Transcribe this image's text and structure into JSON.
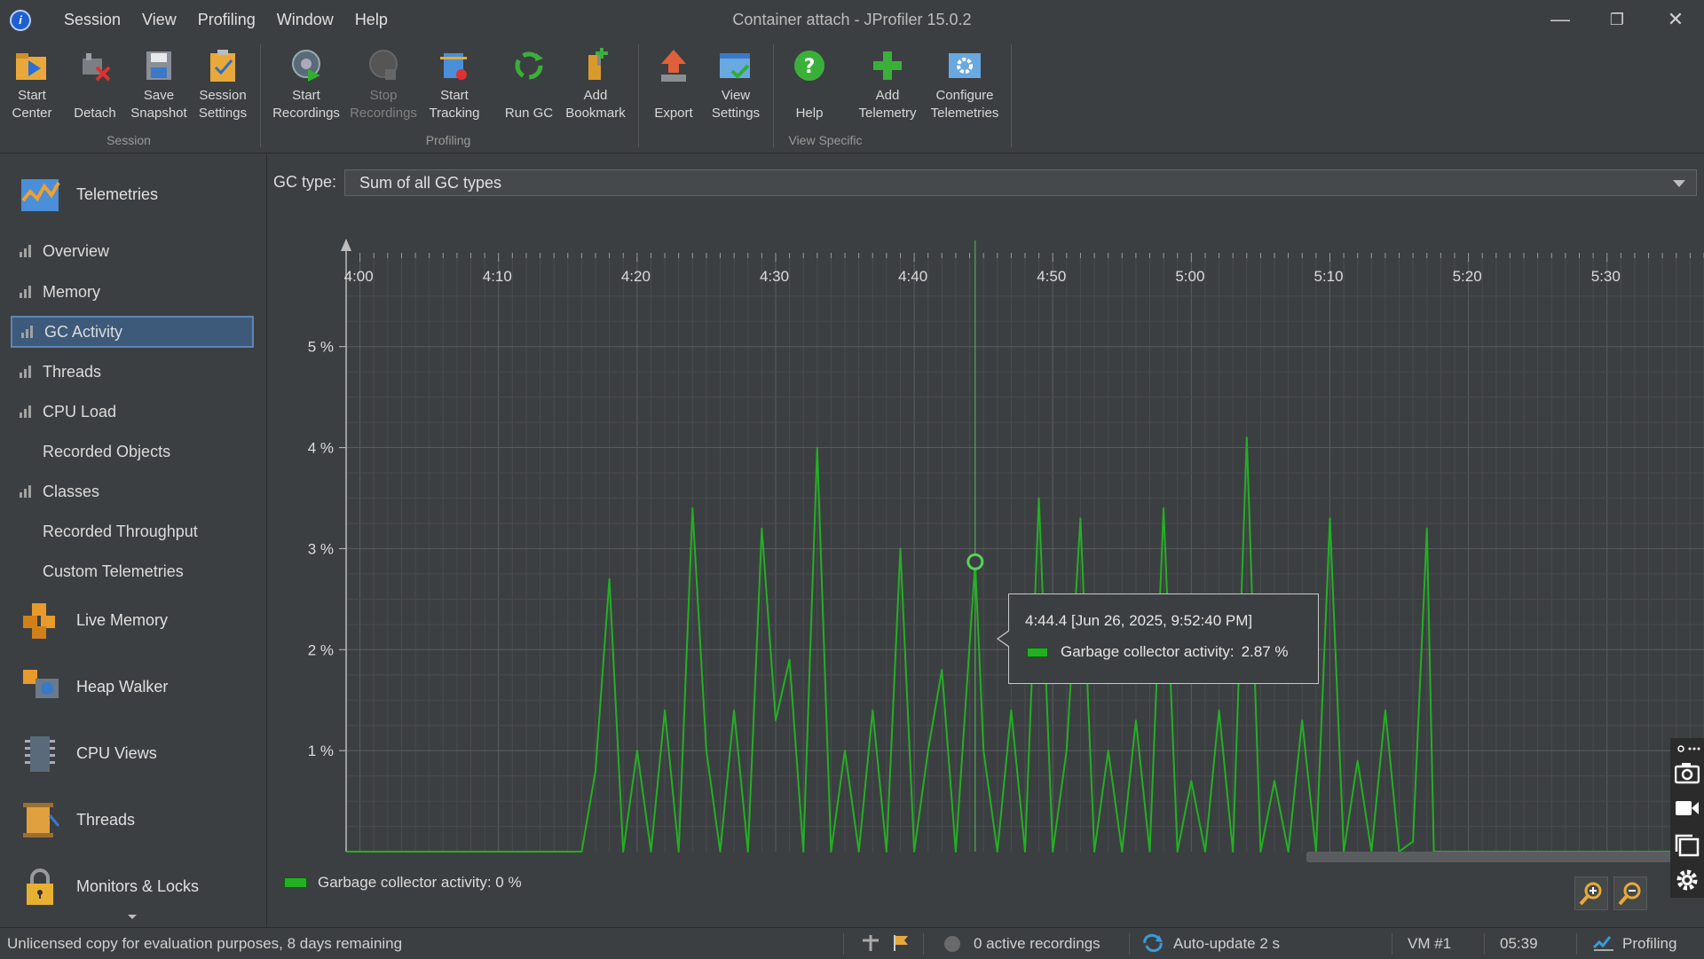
{
  "window": {
    "title": "Container attach - JProfiler 15.0.2",
    "menu": [
      "Session",
      "View",
      "Profiling",
      "Window",
      "Help"
    ],
    "controls": {
      "minimize": "—",
      "restore": "❐",
      "close": "✕"
    }
  },
  "toolbar": {
    "groups": {
      "session": "Session",
      "profiling": "Profiling",
      "view_specific": "View Specific"
    },
    "buttons": {
      "start_center": [
        "Start",
        "Center"
      ],
      "detach": [
        "",
        "Detach"
      ],
      "save_snapshot": [
        "Save",
        "Snapshot"
      ],
      "session_settings": [
        "Session",
        "Settings"
      ],
      "start_recordings": [
        "Start",
        "Recordings"
      ],
      "stop_recordings": [
        "Stop",
        "Recordings"
      ],
      "start_tracking": [
        "Start",
        "Tracking"
      ],
      "run_gc": [
        "",
        "Run GC"
      ],
      "add_bookmark": [
        "Add",
        "Bookmark"
      ],
      "export": [
        "",
        "Export"
      ],
      "view_settings": [
        "View",
        "Settings"
      ],
      "help": [
        "",
        "Help"
      ],
      "add_telemetry": [
        "Add",
        "Telemetry"
      ],
      "configure_telemetries": [
        "Configure",
        "Telemetries"
      ]
    }
  },
  "sidebar": {
    "categories": {
      "telemetries": "Telemetries",
      "live_memory": "Live Memory",
      "heap_walker": "Heap Walker",
      "cpu_views": "CPU Views",
      "threads": "Threads",
      "monitors_locks": "Monitors & Locks"
    },
    "items": [
      {
        "label": "Overview",
        "icon": "bar-chart-icon"
      },
      {
        "label": "Memory",
        "icon": "bar-chart-icon"
      },
      {
        "label": "GC Activity",
        "icon": "bar-chart-icon",
        "selected": true
      },
      {
        "label": "Threads",
        "icon": "bar-chart-icon"
      },
      {
        "label": "CPU Load",
        "icon": "bar-chart-icon"
      },
      {
        "label": "Recorded Objects",
        "icon": ""
      },
      {
        "label": "Classes",
        "icon": "bar-chart-icon"
      },
      {
        "label": "Recorded Throughput",
        "icon": ""
      },
      {
        "label": "Custom Telemetries",
        "icon": ""
      }
    ]
  },
  "main": {
    "gc_type_label": "GC type:",
    "gc_type_value": "Sum of all GC types",
    "legend": "Garbage collector activity:  0 %",
    "tooltip": {
      "time": "4:44.4 [Jun 26, 2025, 9:52:40 PM]",
      "series_label": "Garbage collector activity:",
      "series_value": "2.87 %"
    }
  },
  "chart_data": {
    "type": "line",
    "x_ticks": [
      "4:00",
      "4:10",
      "4:20",
      "4:30",
      "4:40",
      "4:50",
      "5:00",
      "5:10",
      "5:20",
      "5:30"
    ],
    "y_ticks": [
      "1 %",
      "2 %",
      "3 %",
      "4 %",
      "5 %"
    ],
    "xlim": [
      239,
      337
    ],
    "ylim": [
      0,
      5
    ],
    "grid": true,
    "line_color": "#22b022",
    "crosshair_x": 284.4,
    "highlight": {
      "x": 284.4,
      "y": 2.87
    },
    "series": [
      {
        "x": [
          239,
          256,
          257,
          258,
          259,
          260,
          261,
          262,
          263,
          264,
          265,
          266,
          267,
          268,
          269,
          270,
          271,
          272,
          273,
          274,
          275,
          276,
          277,
          278,
          279,
          280,
          281,
          282,
          283,
          284.4,
          285,
          286,
          287,
          288,
          289,
          290,
          291,
          292,
          293,
          294,
          295,
          296,
          297,
          298,
          299,
          300,
          301,
          302,
          303,
          304,
          305,
          306,
          307,
          308,
          309,
          310,
          311,
          312,
          313,
          314,
          315,
          316,
          317,
          317.5,
          337
        ],
        "y": [
          0,
          0,
          0.8,
          2.7,
          0,
          1.0,
          0,
          1.4,
          0,
          3.4,
          1.0,
          0,
          1.4,
          0,
          3.2,
          1.3,
          1.9,
          0,
          4.0,
          0,
          1.0,
          0,
          1.4,
          0,
          3.0,
          0,
          1.0,
          1.8,
          0,
          2.87,
          1.0,
          0,
          1.4,
          0,
          3.5,
          0,
          1.0,
          3.3,
          0,
          1.0,
          0,
          1.3,
          0,
          3.4,
          0,
          0.7,
          0,
          1.4,
          0,
          4.1,
          0,
          0.7,
          0,
          1.3,
          0,
          3.3,
          0,
          0.9,
          0,
          1.4,
          0,
          0.1,
          3.2,
          0,
          0
        ]
      }
    ]
  },
  "statusbar": {
    "license": "Unlicensed copy for evaluation purposes, 8 days remaining",
    "recordings": "0 active recordings",
    "autoupdate": "Auto-update 2 s",
    "vm": "VM #1",
    "time": "05:39",
    "mode": "Profiling"
  }
}
